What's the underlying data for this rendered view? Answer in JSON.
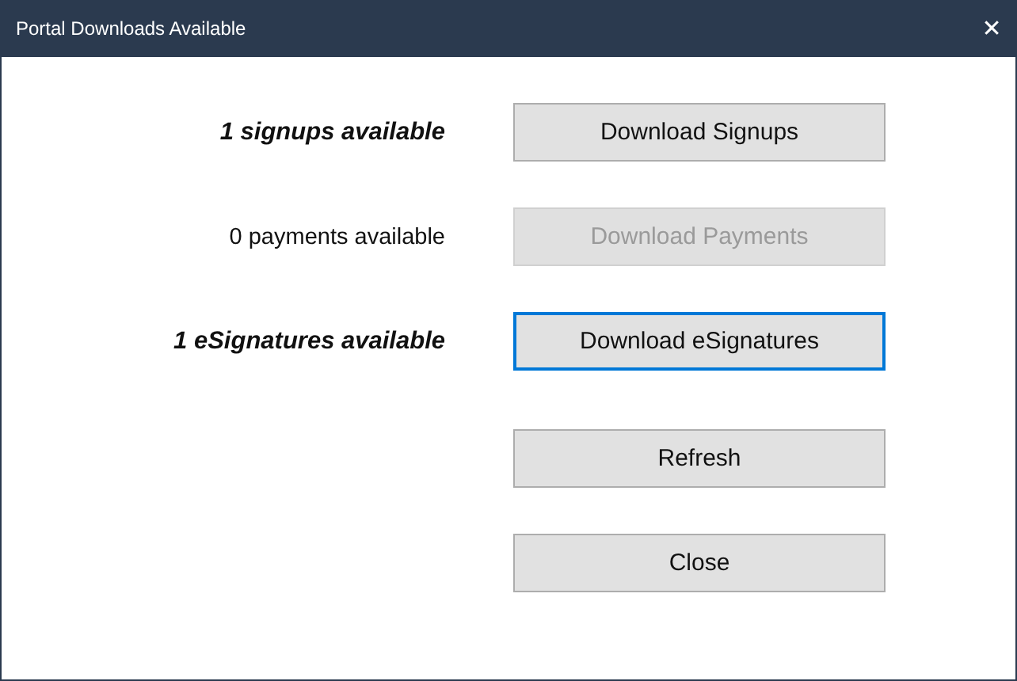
{
  "window": {
    "title": "Portal Downloads Available",
    "close": "✕"
  },
  "downloads": [
    {
      "label": "1 signups available",
      "emphasized": true,
      "button": {
        "label": "Download Signups",
        "disabled": false,
        "focused": false
      }
    },
    {
      "label": "0 payments available",
      "emphasized": false,
      "button": {
        "label": "Download Payments",
        "disabled": true,
        "focused": false
      }
    },
    {
      "label": "1 eSignatures available",
      "emphasized": true,
      "button": {
        "label": "Download eSignatures",
        "disabled": false,
        "focused": true
      }
    }
  ],
  "buttons": [
    {
      "label": "Refresh",
      "disabled": false,
      "focused": false
    },
    {
      "label": "Close",
      "disabled": false,
      "focused": false
    }
  ]
}
